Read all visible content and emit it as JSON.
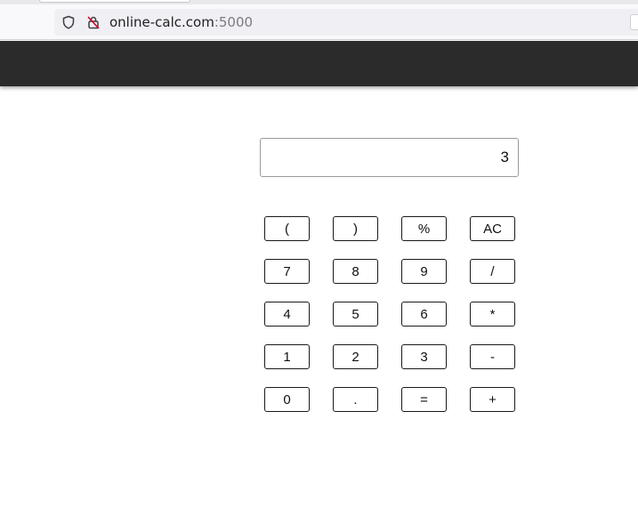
{
  "browser": {
    "url_host": "online-calc.com",
    "url_port": ":5000",
    "icons": [
      "shield-icon",
      "insecure-lock-icon"
    ]
  },
  "calculator": {
    "display_value": "3",
    "keys": [
      [
        "(",
        ")",
        "%",
        "AC"
      ],
      [
        "7",
        "8",
        "9",
        "/"
      ],
      [
        "4",
        "5",
        "6",
        "*"
      ],
      [
        "1",
        "2",
        "3",
        "-"
      ],
      [
        "0",
        ".",
        "=",
        "+"
      ]
    ]
  },
  "colors": {
    "header_bar": "#2b2b2b",
    "key_border": "#1a1a1a",
    "insecure_icon": "#d70022"
  }
}
